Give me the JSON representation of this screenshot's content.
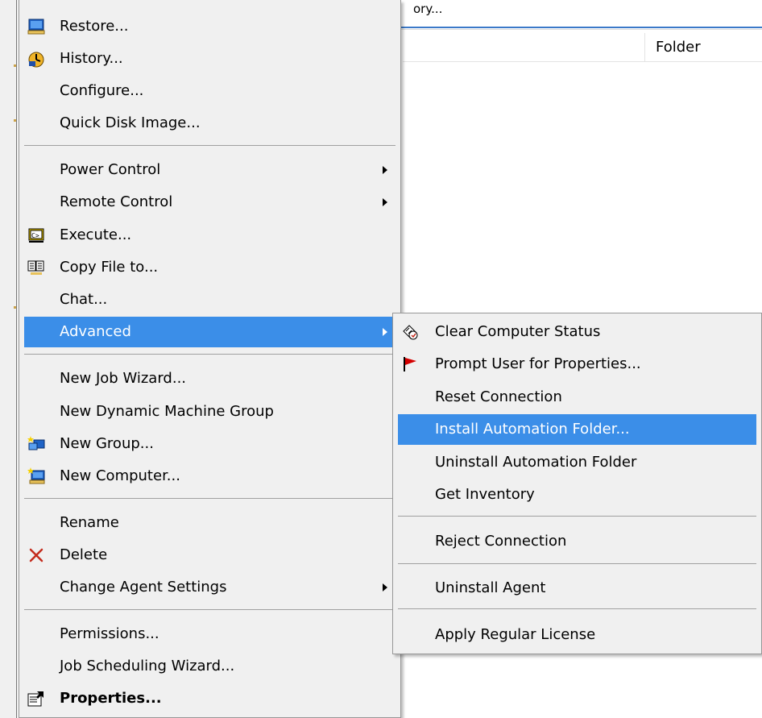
{
  "background": {
    "breadcrumb": "ory...",
    "column_header": "Folder"
  },
  "context_menu": {
    "items": {
      "restore": "Restore...",
      "history": "History...",
      "configure": "Configure...",
      "quick_disk_image": "Quick Disk Image...",
      "power_control": "Power Control",
      "remote_control": "Remote Control",
      "execute": "Execute...",
      "copy_file": "Copy File to...",
      "chat": "Chat...",
      "advanced": "Advanced",
      "new_job_wizard": "New Job Wizard...",
      "new_dynamic_group": "New Dynamic Machine Group",
      "new_group": "New Group...",
      "new_computer": "New Computer...",
      "rename": "Rename",
      "delete": "Delete",
      "change_agent_settings": "Change Agent Settings",
      "permissions": "Permissions...",
      "job_scheduling_wizard": "Job Scheduling Wizard...",
      "properties": "Properties..."
    }
  },
  "submenu": {
    "items": {
      "clear_status": "Clear Computer Status",
      "prompt_user": "Prompt User for Properties...",
      "reset_connection": "Reset Connection",
      "install_automation": "Install Automation Folder...",
      "uninstall_automation": "Uninstall Automation Folder",
      "get_inventory": "Get Inventory",
      "reject_connection": "Reject Connection",
      "uninstall_agent": "Uninstall Agent",
      "apply_license": "Apply Regular License"
    }
  },
  "colors": {
    "highlight": "#3b8ee8",
    "menu_bg": "#f0f0f0",
    "delete_icon": "#c42b1c",
    "flag_icon": "#d40000"
  }
}
